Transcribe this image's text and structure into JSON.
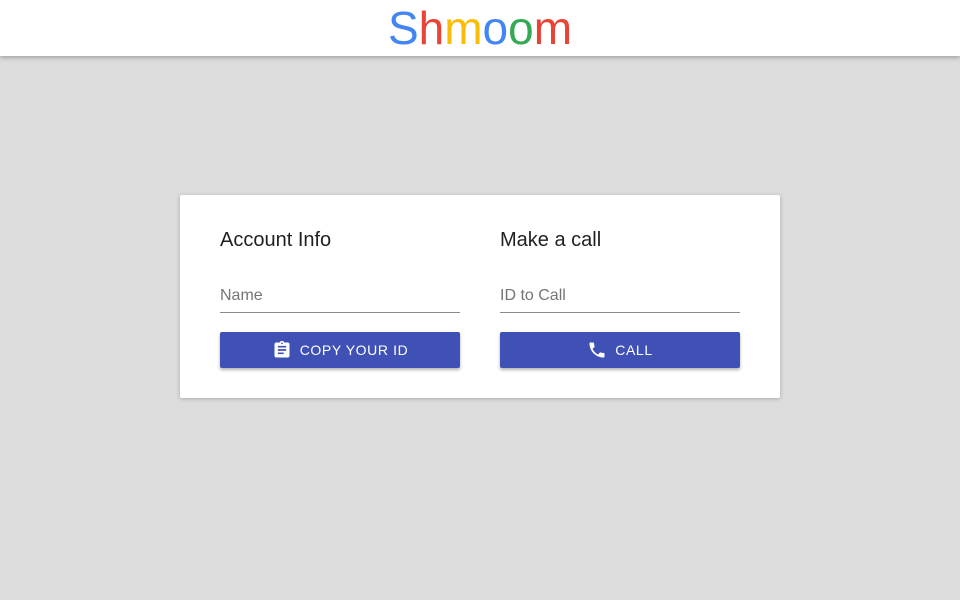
{
  "app": {
    "logo_letters": [
      {
        "char": "S",
        "color": "#4285f4"
      },
      {
        "char": "h",
        "color": "#ea4335"
      },
      {
        "char": "m",
        "color": "#fbbc05"
      },
      {
        "char": "o",
        "color": "#4285f4"
      },
      {
        "char": "o",
        "color": "#34a853"
      },
      {
        "char": "m",
        "color": "#ea4335"
      }
    ]
  },
  "account": {
    "title": "Account Info",
    "name_placeholder": "Name",
    "name_value": "",
    "copy_button_label": "COPY YOUR ID",
    "copy_icon": "clipboard-icon"
  },
  "call": {
    "title": "Make a call",
    "id_placeholder": "ID to Call",
    "id_value": "",
    "call_button_label": "CALL",
    "call_icon": "phone-icon"
  },
  "colors": {
    "background": "#dcdcdc",
    "primary": "#3f51b5",
    "card": "#ffffff"
  }
}
